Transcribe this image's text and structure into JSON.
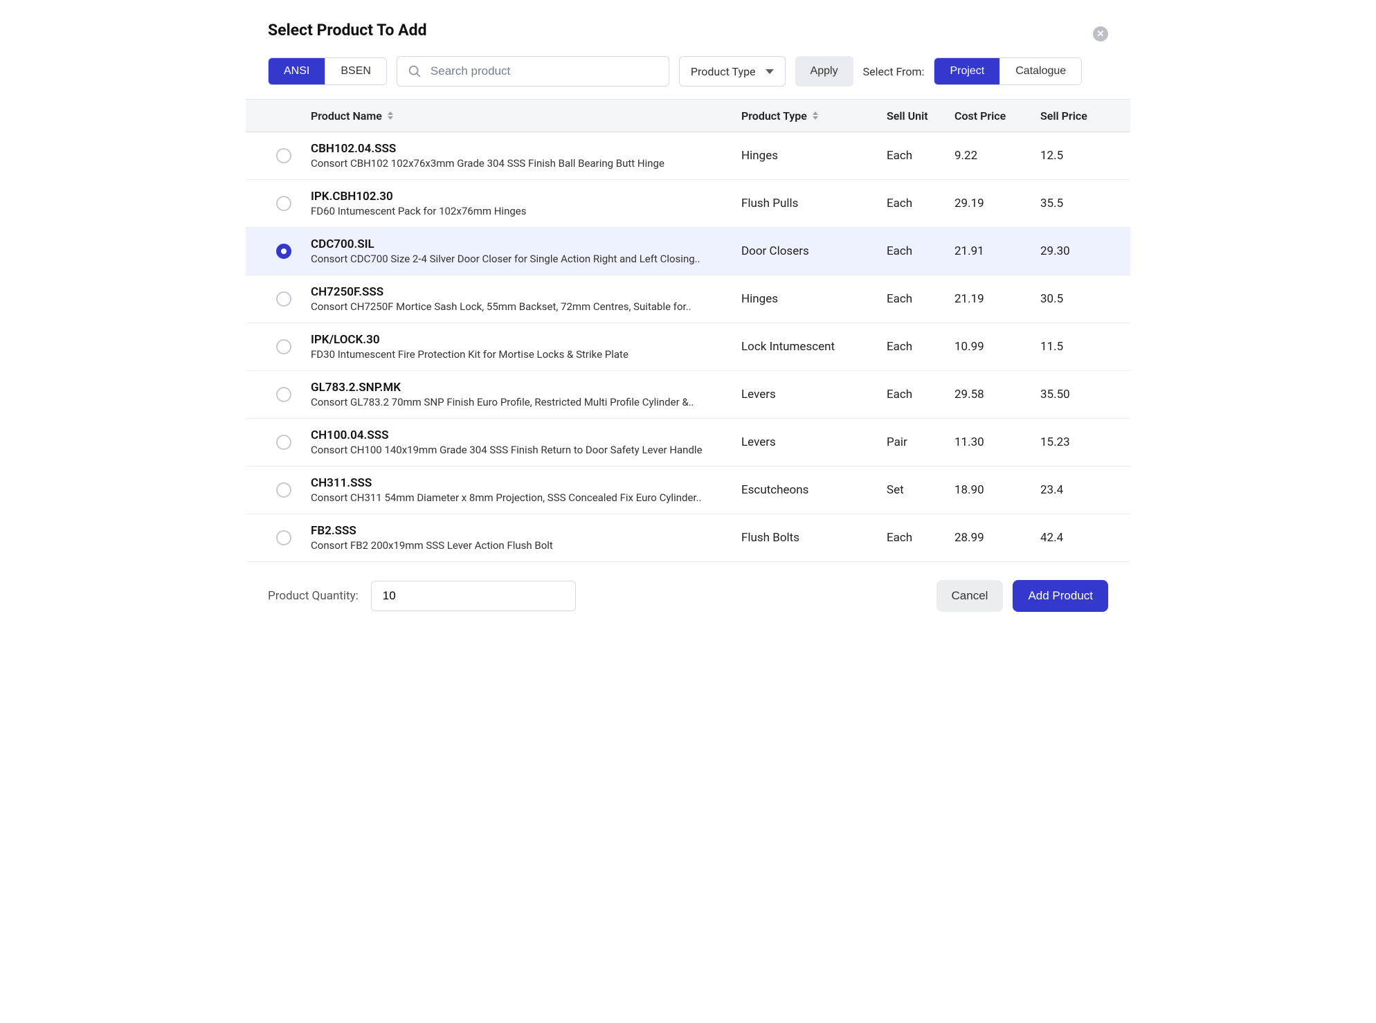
{
  "header": {
    "title": "Select Product To Add"
  },
  "toolbar": {
    "standard_tabs": [
      "ANSI",
      "BSEN"
    ],
    "standard_active": 0,
    "search_placeholder": "Search product",
    "product_type_label": "Product Type",
    "apply_label": "Apply",
    "select_from_label": "Select From:",
    "source_tabs": [
      "Project",
      "Catalogue"
    ],
    "source_active": 0
  },
  "columns": {
    "name": "Product Name",
    "type": "Product Type",
    "unit": "Sell Unit",
    "cost": "Cost Price",
    "sell": "Sell Price"
  },
  "rows": [
    {
      "selected": false,
      "code": "CBH102.04.SSS",
      "desc": "Consort CBH102 102x76x3mm Grade 304 SSS Finish Ball Bearing Butt Hinge",
      "type": "Hinges",
      "unit": "Each",
      "cost": "9.22",
      "sell": "12.5"
    },
    {
      "selected": false,
      "code": "IPK.CBH102.30",
      "desc": "FD60 Intumescent Pack for 102x76mm Hinges",
      "type": "Flush Pulls",
      "unit": "Each",
      "cost": "29.19",
      "sell": "35.5"
    },
    {
      "selected": true,
      "code": "CDC700.SIL",
      "desc": "Consort CDC700 Size 2-4 Silver Door Closer for Single Action Right and Left Closing..",
      "type": "Door Closers",
      "unit": "Each",
      "cost": "21.91",
      "sell": "29.30"
    },
    {
      "selected": false,
      "code": "CH7250F.SSS",
      "desc": "Consort CH7250F Mortice Sash Lock, 55mm Backset, 72mm Centres, Suitable for..",
      "type": "Hinges",
      "unit": "Each",
      "cost": "21.19",
      "sell": "30.5"
    },
    {
      "selected": false,
      "code": "IPK/LOCK.30",
      "desc": "FD30 Intumescent Fire Protection Kit for Mortise Locks & Strike Plate",
      "type": "Lock Intumescent",
      "unit": "Each",
      "cost": "10.99",
      "sell": "11.5"
    },
    {
      "selected": false,
      "code": "GL783.2.SNP.MK",
      "desc": "Consort GL783.2 70mm SNP Finish Euro Profile, Restricted Multi Profile Cylinder &..",
      "type": "Levers",
      "unit": "Each",
      "cost": "29.58",
      "sell": "35.50"
    },
    {
      "selected": false,
      "code": "CH100.04.SSS",
      "desc": "Consort CH100 140x19mm Grade 304 SSS Finish Return to Door Safety Lever Handle",
      "type": "Levers",
      "unit": "Pair",
      "cost": "11.30",
      "sell": "15.23"
    },
    {
      "selected": false,
      "code": "CH311.SSS",
      "desc": "Consort CH311 54mm Diameter x 8mm Projection, SSS Concealed Fix Euro Cylinder..",
      "type": "Escutcheons",
      "unit": "Set",
      "cost": "18.90",
      "sell": "23.4"
    },
    {
      "selected": false,
      "code": "FB2.SSS",
      "desc": "Consort FB2 200x19mm SSS Lever Action Flush Bolt",
      "type": "Flush Bolts",
      "unit": "Each",
      "cost": "28.99",
      "sell": "42.4"
    }
  ],
  "footer": {
    "quantity_label": "Product Quantity:",
    "quantity_value": "10",
    "cancel_label": "Cancel",
    "add_label": "Add Product"
  }
}
